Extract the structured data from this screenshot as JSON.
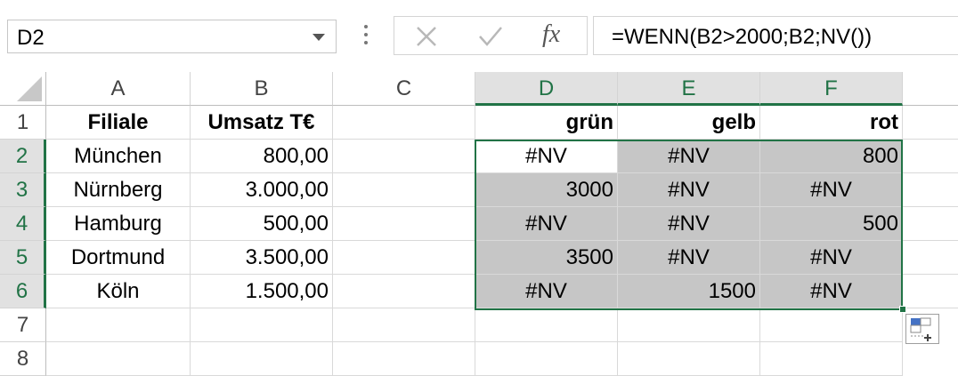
{
  "formula_bar": {
    "name_box": "D2",
    "formula": "=WENN(B2>2000;B2;NV())",
    "fx_label": "fx"
  },
  "columns": [
    "A",
    "B",
    "C",
    "D",
    "E",
    "F"
  ],
  "rows": [
    "1",
    "2",
    "3",
    "4",
    "5",
    "6",
    "7",
    "8"
  ],
  "cells": {
    "r1": {
      "A": "Filiale",
      "B": "Umsatz T€",
      "D": "grün",
      "E": "gelb",
      "F": "rot"
    },
    "r2": {
      "A": "München",
      "B": "800,00",
      "D": "#NV",
      "E": "#NV",
      "F": "800"
    },
    "r3": {
      "A": "Nürnberg",
      "B": "3.000,00",
      "D": "3000",
      "E": "#NV",
      "F": "#NV"
    },
    "r4": {
      "A": "Hamburg",
      "B": "500,00",
      "D": "#NV",
      "E": "#NV",
      "F": "500"
    },
    "r5": {
      "A": "Dortmund",
      "B": "3.500,00",
      "D": "3500",
      "E": "#NV",
      "F": "#NV"
    },
    "r6": {
      "A": "Köln",
      "B": "1.500,00",
      "D": "#NV",
      "E": "1500",
      "F": "#NV"
    }
  },
  "colors": {
    "accent": "#217346",
    "selection_shade": "#c6c6c6"
  }
}
